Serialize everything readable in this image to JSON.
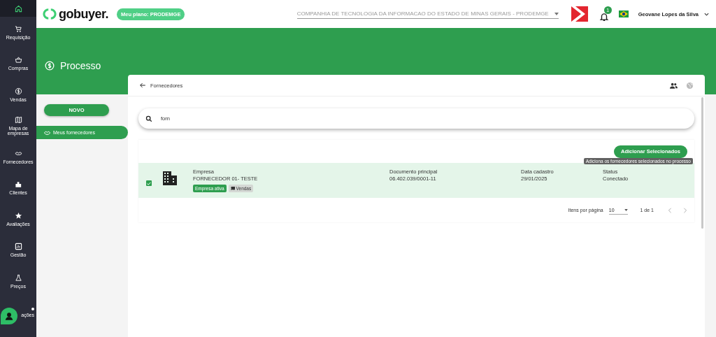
{
  "brand": {
    "logo": "gobuyer.",
    "plan": "Meu plano: PRODEMGE"
  },
  "header": {
    "company": "COMPANHIA DE TECNOLOGIA DA INFORMACAO DO ESTADO DE MINAS GERAIS - PRODEMGE",
    "notifications": "1",
    "user": "Geovane Lopes da Silva"
  },
  "sidebar": {
    "items": [
      {
        "selected": true
      },
      {
        "label": "Requisição",
        "selected": false
      },
      {
        "label": "Compras",
        "selected": false
      },
      {
        "label": "Vendas",
        "selected": false
      },
      {
        "label": "Mapa de empresas",
        "selected": false
      },
      {
        "label": "Fornecedores",
        "selected": false
      },
      {
        "label": "Clientes",
        "selected": false
      },
      {
        "label": "Avaliações",
        "selected": false
      },
      {
        "label": "Gestão",
        "selected": false
      },
      {
        "label": "Preços",
        "selected": false
      },
      {
        "label": "ações",
        "selected": false
      }
    ]
  },
  "page": {
    "title": "Processo",
    "new_button": "NOVO",
    "menu": [
      {
        "label": "Meus fornecedores",
        "selected": true
      }
    ]
  },
  "card": {
    "title": "Fornecedores",
    "search": {
      "value": "forn"
    },
    "add_button": "Adicionar Selecionados",
    "tooltip": "Adiciona os fornecedores selecionados no processo",
    "rows": [
      {
        "checked": true,
        "company_label": "Empresa",
        "company": "FORNECEDOR 01- TESTE",
        "tags": [
          {
            "label": "Empresa ativa",
            "kind": "status"
          },
          {
            "label": "Vendas",
            "kind": "category"
          }
        ],
        "document_label": "Documento principal",
        "document": "06.402.039/0001-11",
        "date_label": "Data cadastro",
        "date": "29/01/2025",
        "status_label": "Status",
        "status": "Conectado"
      }
    ],
    "pagination": {
      "items_per_page_label": "Itens por página",
      "page_size": "10",
      "range": "1 de 1"
    }
  }
}
